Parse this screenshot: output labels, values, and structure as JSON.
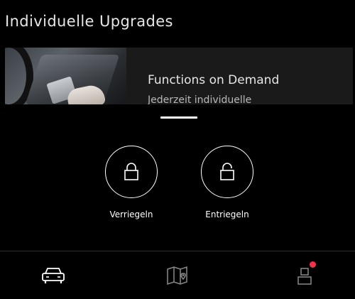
{
  "section": {
    "title": "Individuelle Upgrades"
  },
  "promo": {
    "title": "Functions on Demand",
    "subtitle": "Jederzeit individuelle"
  },
  "actions": {
    "lock_label": "Verriegeln",
    "unlock_label": "Entriegeln"
  },
  "icons": {
    "lock": "lock-icon",
    "unlock": "unlock-icon",
    "vehicle": "car-icon",
    "map": "map-icon",
    "profile": "profile-icon"
  },
  "colors": {
    "background": "#000000",
    "text": "#ffffff",
    "nav_active": "#ffffff",
    "nav_inactive": "#8a8a8a",
    "notification": "#f5314b"
  }
}
